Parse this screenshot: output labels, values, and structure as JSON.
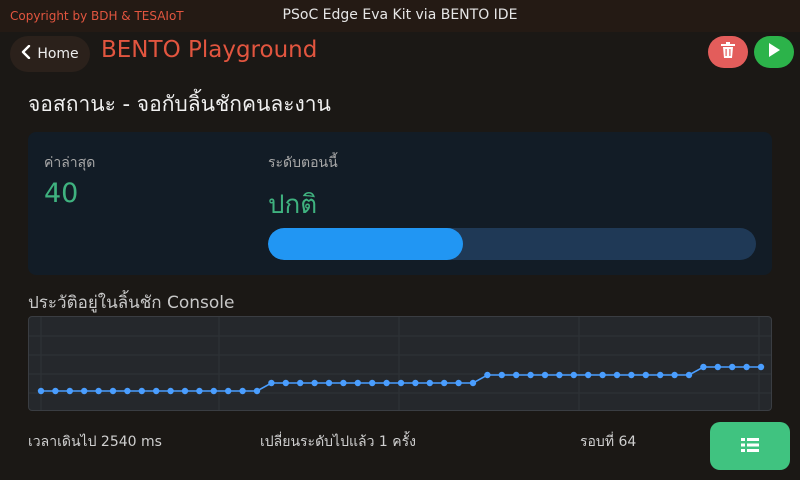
{
  "header": {
    "copyright": "Copyright by BDH & TESAIoT",
    "window_title": "PSoC Edge Eva Kit via BENTO IDE"
  },
  "nav": {
    "home_label": "Home",
    "app_title": "BENTO Playground"
  },
  "page": {
    "title": "จอสถานะ - จอกับลิ้นชักคนละงาน"
  },
  "status_card": {
    "latest_label": "ค่าล่าสุด",
    "latest_value": "40",
    "level_label": "ระดับตอนนี้",
    "level_value": "ปกติ",
    "progress_fraction": 0.4
  },
  "history": {
    "title": "ประวัติอยู่ในลิ้นชัก Console",
    "values": [
      20,
      20,
      20,
      20,
      20,
      20,
      20,
      20,
      20,
      20,
      20,
      20,
      20,
      20,
      20,
      20,
      30,
      30,
      30,
      30,
      30,
      30,
      30,
      30,
      30,
      30,
      30,
      30,
      30,
      30,
      30,
      40,
      40,
      40,
      40,
      40,
      40,
      40,
      40,
      40,
      40,
      40,
      40,
      40,
      40,
      40,
      50,
      50,
      50,
      50,
      50
    ],
    "y_range": [
      0,
      100
    ],
    "point_color": "#4a9eff"
  },
  "footer": {
    "elapsed": "เวลาเดินไป 2540 ms",
    "changes": "เปลี่ยนระดับไปแล้ว 1 ครั้ง",
    "round": "รอบที่ 64"
  },
  "icons": {
    "back": "chevron-left-icon",
    "trash": "trash-icon",
    "play": "play-icon",
    "list": "list-icon"
  },
  "colors": {
    "accent": "#e2553f",
    "value_green": "#3fb27f",
    "progress": "#2196f3",
    "danger": "#e35d5b",
    "run": "#2cb34a",
    "list_button": "#40c380"
  }
}
